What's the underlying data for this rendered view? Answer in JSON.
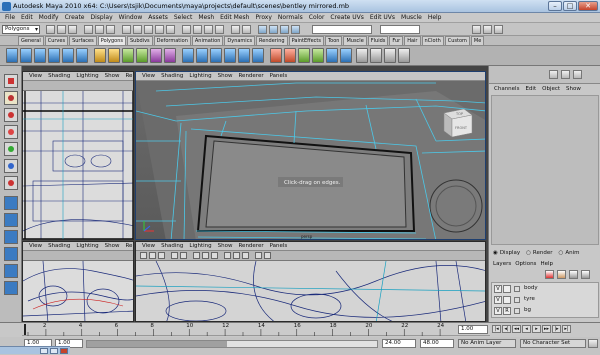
{
  "window": {
    "title": "Autodesk Maya 2010 x64: C:\\Users\\tsjik\\Documents\\maya\\projects\\default\\scenes\\bentley mirrored.mb",
    "minimize": "–",
    "maximize": "□",
    "close": "✕"
  },
  "menubar": [
    "File",
    "Edit",
    "Modify",
    "Create",
    "Display",
    "Window",
    "Assets",
    "Select",
    "Mesh",
    "Edit Mesh",
    "Proxy",
    "Normals",
    "Color",
    "Create UVs",
    "Edit UVs",
    "Muscle",
    "Help"
  ],
  "statusline": {
    "mode": "Polygons"
  },
  "shelf_tabs": [
    "General",
    "Curves",
    "Surfaces",
    "Polygons",
    "Subdivs",
    "Deformation",
    "Animation",
    "Dynamics",
    "Rendering",
    "PaintEffects",
    "Toon",
    "Muscle",
    "Fluids",
    "Fur",
    "Hair",
    "nCloth",
    "Custom",
    "Me"
  ],
  "shelf_active": "Polygons",
  "panel_menu": [
    "View",
    "Shading",
    "Lighting",
    "Show",
    "Renderer",
    "Panels"
  ],
  "panel_menu_short": [
    "View",
    "Shading",
    "Lighting",
    "Show",
    "Rendere"
  ],
  "viewport": {
    "hint": "Click-drag on edges.",
    "viewcube_top": "TOP",
    "viewcube_front": "FRONT",
    "cam_label": "persp"
  },
  "channelbox": {
    "menus": [
      "Channels",
      "Edit",
      "Object",
      "Show"
    ],
    "modes": [
      "Display",
      "Render",
      "Anim"
    ],
    "layer_menus": [
      "Layers",
      "Options",
      "Help"
    ],
    "layers": [
      {
        "v": "V",
        "p": "",
        "name": "body"
      },
      {
        "v": "V",
        "p": "",
        "name": "tyre"
      },
      {
        "v": "V",
        "p": "R",
        "name": "bg"
      }
    ]
  },
  "timeline": {
    "ticks": [
      "2",
      "4",
      "6",
      "8",
      "10",
      "12",
      "14",
      "16",
      "18",
      "20",
      "22",
      "24"
    ],
    "current_frame": "1.00"
  },
  "range": {
    "start": "1.00",
    "start2": "1.00",
    "end": "24.00",
    "end2": "48.00",
    "anim_layer": "No Anim Layer",
    "char_set": "No Character Set"
  }
}
